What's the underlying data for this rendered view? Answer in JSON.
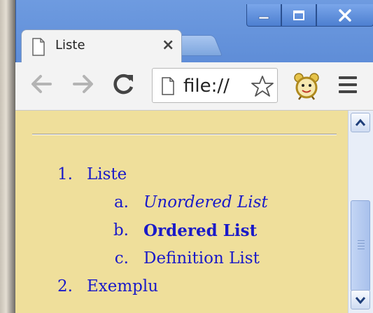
{
  "tab": {
    "title": "Liste",
    "close_glyph": "×"
  },
  "window_controls": {
    "minimize": "minimize-icon",
    "maximize": "maximize-icon",
    "close": "close-icon"
  },
  "toolbar": {
    "back_icon": "back-arrow-icon",
    "forward_icon": "forward-arrow-icon",
    "reload_icon": "reload-icon",
    "address": "file://",
    "bookmark_icon": "star-icon",
    "extension_icon": "alarm-clock-icon",
    "menu_icon": "hamburger-menu-icon"
  },
  "page": {
    "background": "#efdf9b",
    "text_color": "#1a1ac8",
    "list": [
      {
        "marker": "1.",
        "label": "Liste",
        "children": [
          {
            "marker": "a.",
            "label": "Unordered List",
            "style": "italic"
          },
          {
            "marker": "b.",
            "label": "Ordered List",
            "style": "bold"
          },
          {
            "marker": "c.",
            "label": "Definition List",
            "style": "normal"
          }
        ]
      },
      {
        "marker": "2.",
        "label": "Exemplu"
      }
    ]
  },
  "colors": {
    "window_frame": "#4f7fcf",
    "toolbar": "#f3f3f3"
  }
}
